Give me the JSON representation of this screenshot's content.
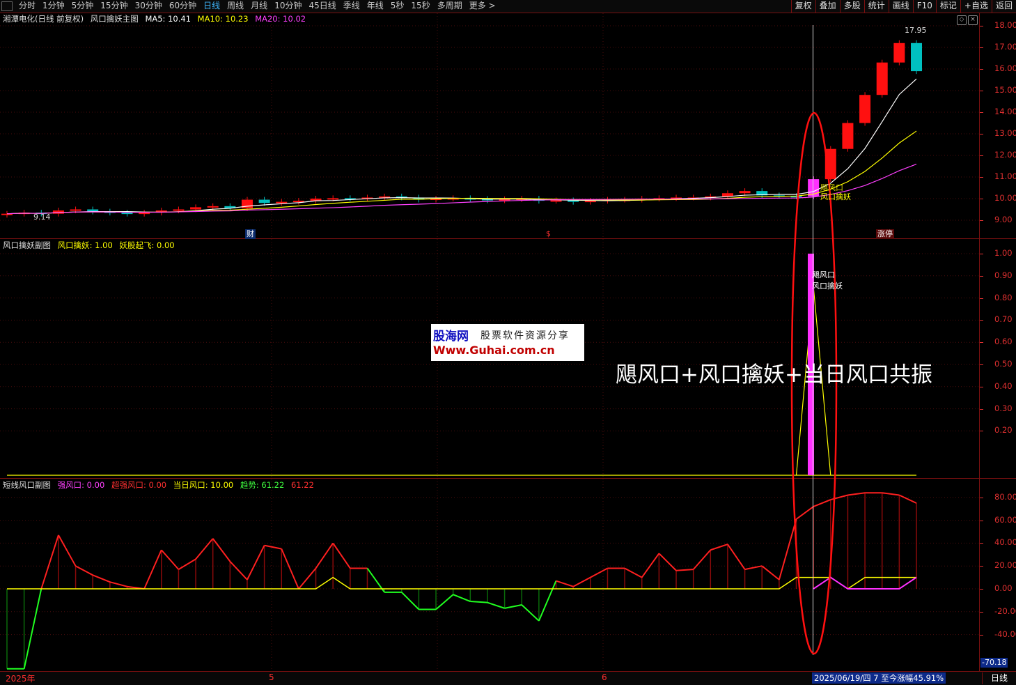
{
  "toolbar": {
    "tabs": [
      "分时",
      "1分钟",
      "5分钟",
      "15分钟",
      "30分钟",
      "60分钟",
      "日线",
      "周线",
      "月线",
      "10分钟",
      "45日线",
      "季线",
      "年线",
      "5秒",
      "15秒",
      "多周期",
      "更多 >"
    ],
    "active_tab": "日线",
    "right_buttons": [
      "复权",
      "叠加",
      "多股",
      "统计",
      "画线",
      "F10",
      "标记",
      "+自选",
      "返回"
    ]
  },
  "main_panel": {
    "stock": "湘潭电化(日线 前复权)",
    "indicator": "风口擒妖主图",
    "ma5": "MA5: 10.41",
    "ma10": "MA10: 10.23",
    "ma20": "MA20: 10.02",
    "ma5_color": "#ffffff",
    "ma10_color": "#ffff00",
    "ma20_color": "#ff40ff",
    "high_label": "17.95",
    "low_label": "9.14",
    "signal1": "飓风口",
    "signal2": "风口擒妖",
    "event_tags": [
      "财",
      "$",
      "涨停"
    ],
    "yaxis": [
      "18.00",
      "17.00",
      "16.00",
      "15.00",
      "14.00",
      "13.00",
      "12.00",
      "11.00",
      "10.00",
      "9.00"
    ]
  },
  "sub1": {
    "title": "风口擒妖副图",
    "v1": "风口擒妖: 1.00",
    "v2": "妖股起飞: 0.00",
    "annot1": "飓风口",
    "annot2": "风口擒妖",
    "yaxis": [
      "1.00",
      "0.90",
      "0.80",
      "0.70",
      "0.60",
      "0.50",
      "0.40",
      "0.30",
      "0.20"
    ]
  },
  "sub2": {
    "title": "短线风口副图",
    "v1": "强风口: 0.00",
    "v2": "超强风口: 0.00",
    "v3": "当日风口: 10.00",
    "v4": "趋势: 61.22",
    "v5": "61.22",
    "yaxis": [
      "80.00",
      "60.00",
      "40.00",
      "20.00",
      "0.00",
      "-20.00",
      "-40.00"
    ],
    "min_label": "-70.18"
  },
  "chart_data": {
    "type": "line",
    "series": [
      {
        "name": "趋势",
        "values": [
          -70,
          -70,
          0,
          47,
          20,
          12,
          6,
          2,
          0,
          34,
          17,
          26,
          44,
          24,
          8,
          38,
          35,
          0,
          18,
          40,
          18,
          18,
          -3,
          -3,
          -18,
          -18,
          -5,
          -11,
          -12,
          -17,
          -14,
          -28,
          7,
          2,
          10,
          18,
          18,
          10,
          31,
          16,
          17,
          34,
          39,
          17,
          20,
          8,
          61,
          72,
          78,
          82,
          84,
          84,
          82,
          75
        ]
      },
      {
        "name": "当日风口",
        "values": [
          0,
          0,
          0,
          0,
          0,
          0,
          0,
          0,
          0,
          0,
          0,
          0,
          0,
          0,
          0,
          0,
          0,
          0,
          0,
          10,
          0,
          0,
          0,
          0,
          0,
          0,
          0,
          0,
          0,
          0,
          0,
          0,
          0,
          0,
          0,
          0,
          0,
          0,
          0,
          0,
          0,
          0,
          0,
          0,
          0,
          0,
          10,
          10,
          10,
          0,
          10,
          10,
          10,
          10
        ]
      },
      {
        "name": "风口擒妖",
        "values": [
          0,
          0,
          0,
          0,
          0,
          0,
          0,
          0,
          0,
          0,
          0,
          0,
          0,
          0,
          0,
          0,
          0,
          0,
          0,
          0,
          0,
          0,
          0,
          0,
          0,
          0,
          0,
          0,
          0,
          0,
          0,
          0,
          0,
          0,
          0,
          0,
          0,
          0,
          0,
          0,
          0,
          0,
          0,
          0,
          0,
          0,
          0,
          1,
          0,
          0,
          0,
          0,
          0,
          0
        ]
      }
    ]
  },
  "watermark": {
    "line1": "股海网",
    "line1b": "股票软件资源分享",
    "line2": "Www.Guhai.com.cn"
  },
  "caption": "飓风口+风口擒妖+当日风口共振",
  "bottom": {
    "date_left": "2025年",
    "m5": "5",
    "m6": "6",
    "date_info": "2025/06/19/四 7 至今涨幅45.91%",
    "period": "日线"
  }
}
